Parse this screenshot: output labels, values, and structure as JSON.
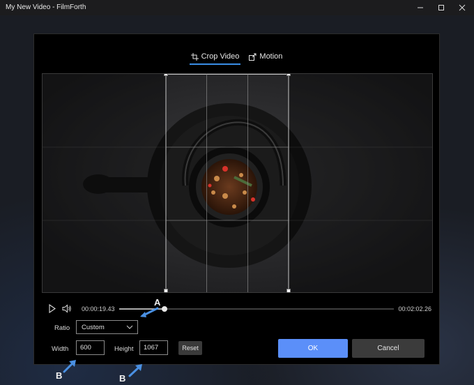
{
  "window": {
    "title": "My New Video - FilmForth"
  },
  "tabs": [
    {
      "label": "Crop Video",
      "icon": "crop-icon",
      "active": true
    },
    {
      "label": "Motion",
      "icon": "motion-icon",
      "active": false
    }
  ],
  "player": {
    "current_time": "00:00:19.43",
    "total_time": "00:02:02.26",
    "progress": 0.165
  },
  "ratio": {
    "label": "Ratio",
    "value": "Custom"
  },
  "dimensions": {
    "width_label": "Width",
    "width_value": "600",
    "height_label": "Height",
    "height_value": "1067"
  },
  "buttons": {
    "reset": "Reset",
    "ok": "OK",
    "cancel": "Cancel"
  },
  "annotations": {
    "a": "A",
    "b1": "B",
    "b2": "B"
  },
  "colors": {
    "accent": "#3a8ee6",
    "ok_button": "#5b8ff9",
    "annotation_arrow": "#4a90e2"
  }
}
